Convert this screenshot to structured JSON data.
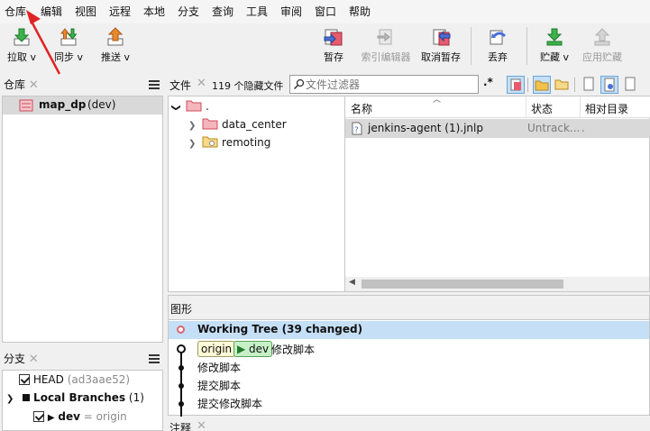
{
  "menu": [
    "仓库",
    "编辑",
    "视图",
    "远程",
    "本地",
    "分支",
    "查询",
    "工具",
    "审阅",
    "窗口",
    "帮助"
  ],
  "toolbar": {
    "fetch": "拉取 v",
    "sync": "同步 v",
    "push": "推送 v",
    "stage": "暂存",
    "index_editor": "索引编辑器",
    "unstage": "取消暂存",
    "discard": "丢弃",
    "stash": "贮藏 v",
    "apply_stash": "应用贮藏"
  },
  "repo_panel": {
    "title": "仓库",
    "repo_name": "map_dp",
    "repo_branch": "(dev)"
  },
  "files_panel": {
    "title": "文件",
    "hidden_files": "119 个隐藏文件",
    "filter_placeholder": "文件过滤器",
    "regex_toggle": ".*",
    "tree_root": ".",
    "tree": [
      "data_center",
      "remoting"
    ],
    "columns": [
      "名称",
      "状态",
      "相对目录"
    ],
    "rows": [
      {
        "name": "jenkins-agent (1).jnlp",
        "status": "Untrack...",
        "dir": "."
      }
    ]
  },
  "graph_panel": {
    "title": "图形",
    "working_tree": "Working Tree (39 changed)",
    "commits": [
      {
        "origin_tag": "origin",
        "branch_tag": "dev",
        "message": "修改脚本"
      },
      {
        "message": "修改脚本"
      },
      {
        "message": "提交脚本"
      },
      {
        "message": "提交修改脚本"
      }
    ]
  },
  "branches_panel": {
    "title": "分支",
    "head_label": "HEAD",
    "head_hash": "(ad3aae52)",
    "local_branches": "Local Branches",
    "local_count": "(1)",
    "dev_name": "dev",
    "dev_tracking": "= origin"
  },
  "notes_panel": {
    "title": "注释"
  },
  "colors": {
    "selection": "#d9d9d9",
    "graph_selection": "#c5dff6",
    "origin_tag_bg": "#fff9d6",
    "dev_tag_bg": "#c7f0c7",
    "arrow": "#e02424"
  }
}
